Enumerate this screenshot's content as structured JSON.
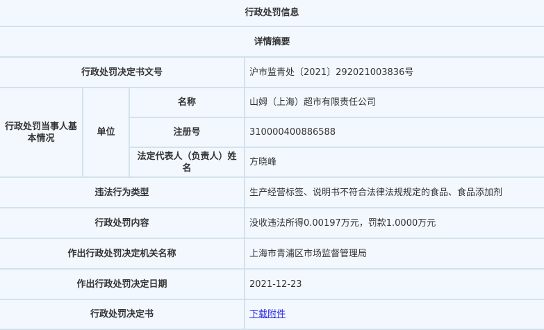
{
  "title": "行政处罚信息",
  "subtitle": "详情摘要",
  "rows": {
    "doc_number": {
      "label": "行政处罚决定书文号",
      "value": "沪市监青处〔2021〕292021003836号"
    },
    "party_label": "行政处罚当事人基本情况",
    "unit_label": "单位",
    "name": {
      "label": "名称",
      "value": "山姆（上海）超市有限责任公司"
    },
    "reg_no": {
      "label": "注册号",
      "value": "310000400886588"
    },
    "legal_rep": {
      "label": "法定代表人（负责人）姓名",
      "value": "方晓峰"
    },
    "violation_type": {
      "label": "违法行为类型",
      "value": "生产经营标签、说明书不符合法律法规规定的食品、食品添加剂"
    },
    "penalty_content": {
      "label": "行政处罚内容",
      "value": "没收违法所得0.00197万元，罚款1.0000万元"
    },
    "authority": {
      "label": "作出行政处罚决定机关名称",
      "value": "上海市青浦区市场监督管理局"
    },
    "date": {
      "label": "作出行政处罚决定日期",
      "value": "2021-12-23"
    },
    "decision_doc": {
      "label": "行政处罚决定书",
      "link": "下载附件"
    }
  }
}
